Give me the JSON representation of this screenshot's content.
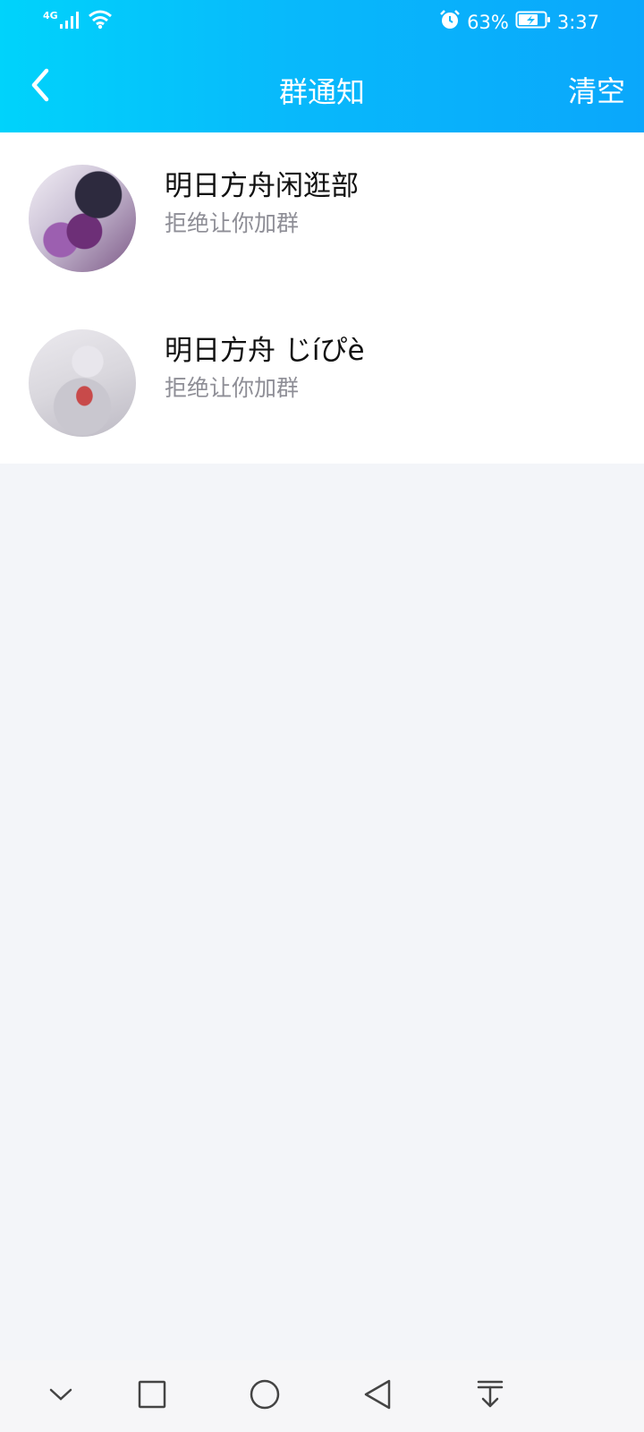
{
  "status_bar": {
    "network": "4G",
    "battery": "63%",
    "time": "3:37"
  },
  "header": {
    "title": "群通知",
    "clear_label": "清空"
  },
  "notifications": [
    {
      "group_name": "明日方舟闲逛部",
      "status": "拒绝让你加群"
    },
    {
      "group_name": "明日方舟 じíぴè",
      "status": "拒绝让你加群"
    }
  ],
  "nav_bar": [
    "collapse",
    "recents",
    "home",
    "back",
    "notifications-pull"
  ],
  "colors": {
    "header_start": "#00d3fb",
    "header_end": "#0aa7fb",
    "background": "#f3f5f9"
  }
}
